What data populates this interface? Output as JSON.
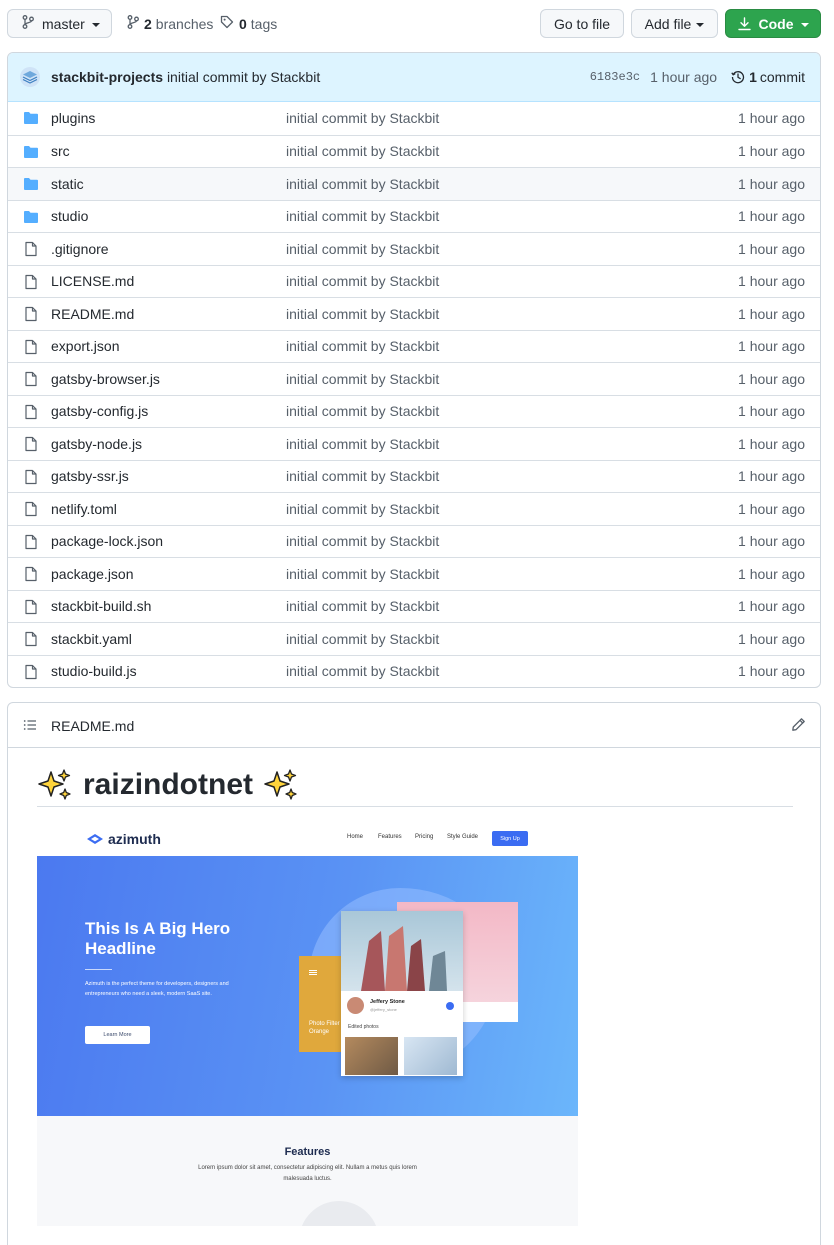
{
  "toolbar": {
    "branch": "master",
    "branches_count": "2",
    "branches_label": "branches",
    "tags_count": "0",
    "tags_label": "tags",
    "goto_file": "Go to file",
    "add_file": "Add file",
    "code": "Code"
  },
  "latest_commit": {
    "author": "stackbit-projects",
    "message": "initial commit by Stackbit",
    "sha": "6183e3c",
    "time": "1 hour ago",
    "commits_count": "1",
    "commits_label": "commit"
  },
  "files": [
    {
      "name": "plugins",
      "type": "folder",
      "message": "initial commit by Stackbit",
      "time": "1 hour ago"
    },
    {
      "name": "src",
      "type": "folder",
      "message": "initial commit by Stackbit",
      "time": "1 hour ago"
    },
    {
      "name": "static",
      "type": "folder",
      "message": "initial commit by Stackbit",
      "time": "1 hour ago"
    },
    {
      "name": "studio",
      "type": "folder",
      "message": "initial commit by Stackbit",
      "time": "1 hour ago"
    },
    {
      "name": ".gitignore",
      "type": "file",
      "message": "initial commit by Stackbit",
      "time": "1 hour ago"
    },
    {
      "name": "LICENSE.md",
      "type": "file",
      "message": "initial commit by Stackbit",
      "time": "1 hour ago"
    },
    {
      "name": "README.md",
      "type": "file",
      "message": "initial commit by Stackbit",
      "time": "1 hour ago"
    },
    {
      "name": "export.json",
      "type": "file",
      "message": "initial commit by Stackbit",
      "time": "1 hour ago"
    },
    {
      "name": "gatsby-browser.js",
      "type": "file",
      "message": "initial commit by Stackbit",
      "time": "1 hour ago"
    },
    {
      "name": "gatsby-config.js",
      "type": "file",
      "message": "initial commit by Stackbit",
      "time": "1 hour ago"
    },
    {
      "name": "gatsby-node.js",
      "type": "file",
      "message": "initial commit by Stackbit",
      "time": "1 hour ago"
    },
    {
      "name": "gatsby-ssr.js",
      "type": "file",
      "message": "initial commit by Stackbit",
      "time": "1 hour ago"
    },
    {
      "name": "netlify.toml",
      "type": "file",
      "message": "initial commit by Stackbit",
      "time": "1 hour ago"
    },
    {
      "name": "package-lock.json",
      "type": "file",
      "message": "initial commit by Stackbit",
      "time": "1 hour ago"
    },
    {
      "name": "package.json",
      "type": "file",
      "message": "initial commit by Stackbit",
      "time": "1 hour ago"
    },
    {
      "name": "stackbit-build.sh",
      "type": "file",
      "message": "initial commit by Stackbit",
      "time": "1 hour ago"
    },
    {
      "name": "stackbit.yaml",
      "type": "file",
      "message": "initial commit by Stackbit",
      "time": "1 hour ago"
    },
    {
      "name": "studio-build.js",
      "type": "file",
      "message": "initial commit by Stackbit",
      "time": "1 hour ago"
    }
  ],
  "readme": {
    "filename": "README.md",
    "title": "raizindotnet",
    "title_emoji": "sparkles-icon",
    "preview": {
      "logo": "azimuth",
      "nav": [
        "Home",
        "Features",
        "Pricing",
        "Style Guide"
      ],
      "signup": "Sign Up",
      "headline": "This Is A Big Hero Headline",
      "description": "Azimuth is the perfect theme for developers, designers and entrepreneurs who need a sleek, modern SaaS site.",
      "learn_more": "Learn More",
      "card_name": "Jeffery Stone",
      "card_handle": "@jeffery_stone",
      "card_caption": "Edited photos",
      "orange_caption": "Photo Filter Orange",
      "features_title": "Features",
      "features_text": "Lorem ipsum dolor sit amet, consectetur adipiscing elit. Nullam a metus quis lorem malesuada luctus."
    }
  },
  "colors": {
    "code_button": "#2da44e",
    "folder_icon": "#54aeff",
    "commit_bar": "#ddf4ff",
    "hero_gradient_start": "#4b79f0",
    "hero_gradient_end": "#6bb6fb"
  }
}
